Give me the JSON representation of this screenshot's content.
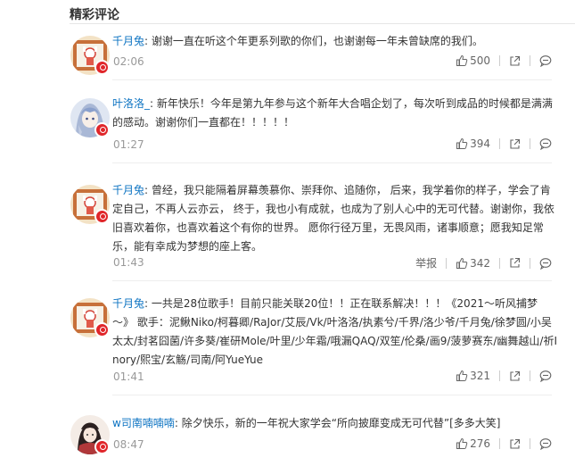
{
  "section_title": "精彩评论",
  "comments": [
    {
      "nick": "千月兔",
      "sep": ":",
      "content": " 谢谢一直在听这个年更系列歌的你们，也谢谢每一年未曾缺席的我们。",
      "time": "02:06",
      "likes": "500",
      "report": ""
    },
    {
      "nick": "叶洛洛_",
      "sep": ":",
      "content": " 新年快乐！今年是第九年参与这个新年大合唱企划了，每次听到成品的时候都是满满的感动。谢谢你们一直都在！！！！！",
      "time": "01:27",
      "likes": "394",
      "report": ""
    },
    {
      "nick": "千月兔",
      "sep": ":",
      "content": " 曾经，我只能隔着屏幕羡慕你、崇拜你、追随你， 后来，我学着你的样子，学会了肯定自己，不再人云亦云， 终于，我也小有成就，也成为了别人心中的无可代替。谢谢你，我依旧喜欢着你，也喜欢着这个有你的世界。 愿你行径万里，无畏风雨，诸事顺意；愿我知足常乐，能有幸成为梦想的座上客。",
      "time": "01:43",
      "likes": "342",
      "report": "举报"
    },
    {
      "nick": "千月兔",
      "sep": ":",
      "content": " 一共是28位歌手！目前只能关联20位！！正在联系解决！！！《2021～听风捕梦～》 歌手：泥鳅Niko/柯暮卿/RaJor/艾辰/Vk/叶洛洛/执素兮/千界/洛少爷/千月兔/徐梦圆/小吴太太/封茗囧菌/许多葵/崔研Mole/叶里/少年霜/哦漏QAQ/双笙/伦桑/画9/菠萝赛东/幽舞越山/祈Inory/熙宝/玄觞/司南/阿YueYue",
      "time": "01:41",
      "likes": "321",
      "report": ""
    },
    {
      "nick": "w司南喃喃喃",
      "sep": ":",
      "content": " 除夕快乐，新的一年祝大家学会“所向披靡变成无可代替”[多多大笑]",
      "time": "08:47",
      "likes": "276",
      "report": ""
    }
  ],
  "colors": {
    "nick": "#0c73c2",
    "time": "#999999",
    "badge": "#e0262a"
  },
  "icons": {
    "like": "thumb-up-icon",
    "share": "share-icon",
    "reply": "reply-icon"
  }
}
